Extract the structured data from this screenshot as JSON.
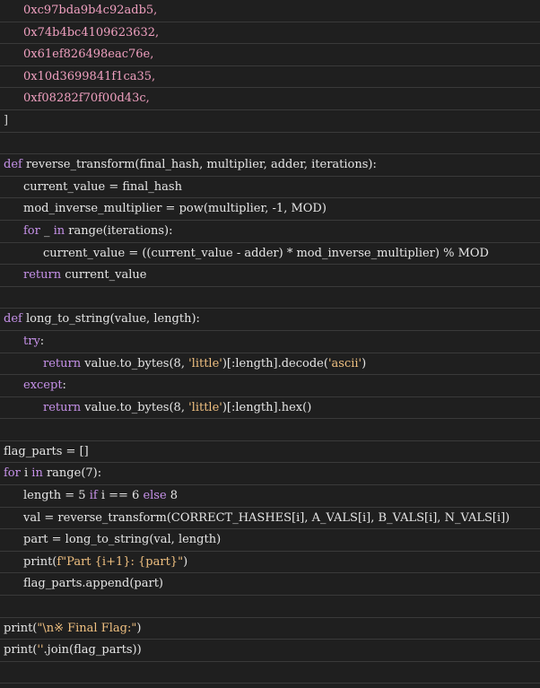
{
  "lines": [
    {
      "indent": 1,
      "tokens": [
        {
          "t": "0xc97bda9b4c92adb5,",
          "c": "hex"
        }
      ]
    },
    {
      "indent": 1,
      "tokens": [
        {
          "t": "0x74b4bc4109623632,",
          "c": "hex"
        }
      ]
    },
    {
      "indent": 1,
      "tokens": [
        {
          "t": "0x61ef826498eac76e,",
          "c": "hex"
        }
      ]
    },
    {
      "indent": 1,
      "tokens": [
        {
          "t": "0x10d3699841f1ca35,",
          "c": "hex"
        }
      ]
    },
    {
      "indent": 1,
      "tokens": [
        {
          "t": "0xf08282f70f00d43c,",
          "c": "hex"
        }
      ]
    },
    {
      "indent": 0,
      "tokens": [
        {
          "t": "]",
          "c": "punct"
        }
      ]
    },
    {
      "indent": 0,
      "tokens": []
    },
    {
      "indent": 0,
      "tokens": [
        {
          "t": "def ",
          "c": "kw"
        },
        {
          "t": "reverse_transform(final_hash, multiplier, adder, iterations):",
          "c": "fn"
        }
      ]
    },
    {
      "indent": 1,
      "tokens": [
        {
          "t": "current_value = final_hash",
          "c": "fn"
        }
      ]
    },
    {
      "indent": 1,
      "tokens": [
        {
          "t": "mod_inverse_multiplier = pow(multiplier, -1, MOD)",
          "c": "fn"
        }
      ]
    },
    {
      "indent": 1,
      "tokens": [
        {
          "t": "for",
          "c": "kw"
        },
        {
          "t": " _ ",
          "c": "fn"
        },
        {
          "t": "in",
          "c": "kw"
        },
        {
          "t": " range(iterations):",
          "c": "fn"
        }
      ]
    },
    {
      "indent": 2,
      "tokens": [
        {
          "t": "current_value = ((current_value - adder) * mod_inverse_multiplier) % MOD",
          "c": "fn"
        }
      ]
    },
    {
      "indent": 1,
      "tokens": [
        {
          "t": "return",
          "c": "kw"
        },
        {
          "t": " current_value",
          "c": "fn"
        }
      ]
    },
    {
      "indent": 0,
      "tokens": []
    },
    {
      "indent": 0,
      "tokens": [
        {
          "t": "def ",
          "c": "kw"
        },
        {
          "t": "long_to_string(value, length):",
          "c": "fn"
        }
      ]
    },
    {
      "indent": 1,
      "tokens": [
        {
          "t": "try",
          "c": "kw"
        },
        {
          "t": ":",
          "c": "fn"
        }
      ]
    },
    {
      "indent": 2,
      "tokens": [
        {
          "t": "return",
          "c": "kw"
        },
        {
          "t": " value.to_bytes(8, ",
          "c": "fn"
        },
        {
          "t": "'little'",
          "c": "str"
        },
        {
          "t": ")[:length].decode(",
          "c": "fn"
        },
        {
          "t": "'ascii'",
          "c": "str"
        },
        {
          "t": ")",
          "c": "fn"
        }
      ]
    },
    {
      "indent": 1,
      "tokens": [
        {
          "t": "except",
          "c": "kw"
        },
        {
          "t": ":",
          "c": "fn"
        }
      ]
    },
    {
      "indent": 2,
      "tokens": [
        {
          "t": "return",
          "c": "kw"
        },
        {
          "t": " value.to_bytes(8, ",
          "c": "fn"
        },
        {
          "t": "'little'",
          "c": "str"
        },
        {
          "t": ")[:length].hex()",
          "c": "fn"
        }
      ]
    },
    {
      "indent": 0,
      "tokens": []
    },
    {
      "indent": 0,
      "tokens": [
        {
          "t": "flag_parts = []",
          "c": "fn"
        }
      ]
    },
    {
      "indent": 0,
      "tokens": [
        {
          "t": "for",
          "c": "kw"
        },
        {
          "t": " i ",
          "c": "fn"
        },
        {
          "t": "in",
          "c": "kw"
        },
        {
          "t": " range(7):",
          "c": "fn"
        }
      ]
    },
    {
      "indent": 1,
      "tokens": [
        {
          "t": "length = 5 ",
          "c": "fn"
        },
        {
          "t": "if",
          "c": "kw"
        },
        {
          "t": " i == 6 ",
          "c": "fn"
        },
        {
          "t": "else",
          "c": "kw"
        },
        {
          "t": " 8",
          "c": "fn"
        }
      ]
    },
    {
      "indent": 1,
      "tokens": [
        {
          "t": "val = reverse_transform(CORRECT_HASHES[i], A_VALS[i], B_VALS[i], N_VALS[i])",
          "c": "fn"
        }
      ]
    },
    {
      "indent": 1,
      "tokens": [
        {
          "t": "part = long_to_string(val, length)",
          "c": "fn"
        }
      ]
    },
    {
      "indent": 1,
      "tokens": [
        {
          "t": "print(",
          "c": "fn"
        },
        {
          "t": "f\"Part {i+1}: {part}\"",
          "c": "str"
        },
        {
          "t": ")",
          "c": "fn"
        }
      ]
    },
    {
      "indent": 1,
      "tokens": [
        {
          "t": "flag_parts.append(part)",
          "c": "fn"
        }
      ]
    },
    {
      "indent": 0,
      "tokens": []
    },
    {
      "indent": 0,
      "tokens": [
        {
          "t": "print(",
          "c": "fn"
        },
        {
          "t": "\"\\n※ Final Flag:\"",
          "c": "str"
        },
        {
          "t": ")",
          "c": "fn"
        }
      ]
    },
    {
      "indent": 0,
      "tokens": [
        {
          "t": "print(",
          "c": "fn"
        },
        {
          "t": "''",
          "c": "str"
        },
        {
          "t": ".join(flag_parts))",
          "c": "fn"
        }
      ]
    },
    {
      "indent": 0,
      "tokens": []
    }
  ]
}
